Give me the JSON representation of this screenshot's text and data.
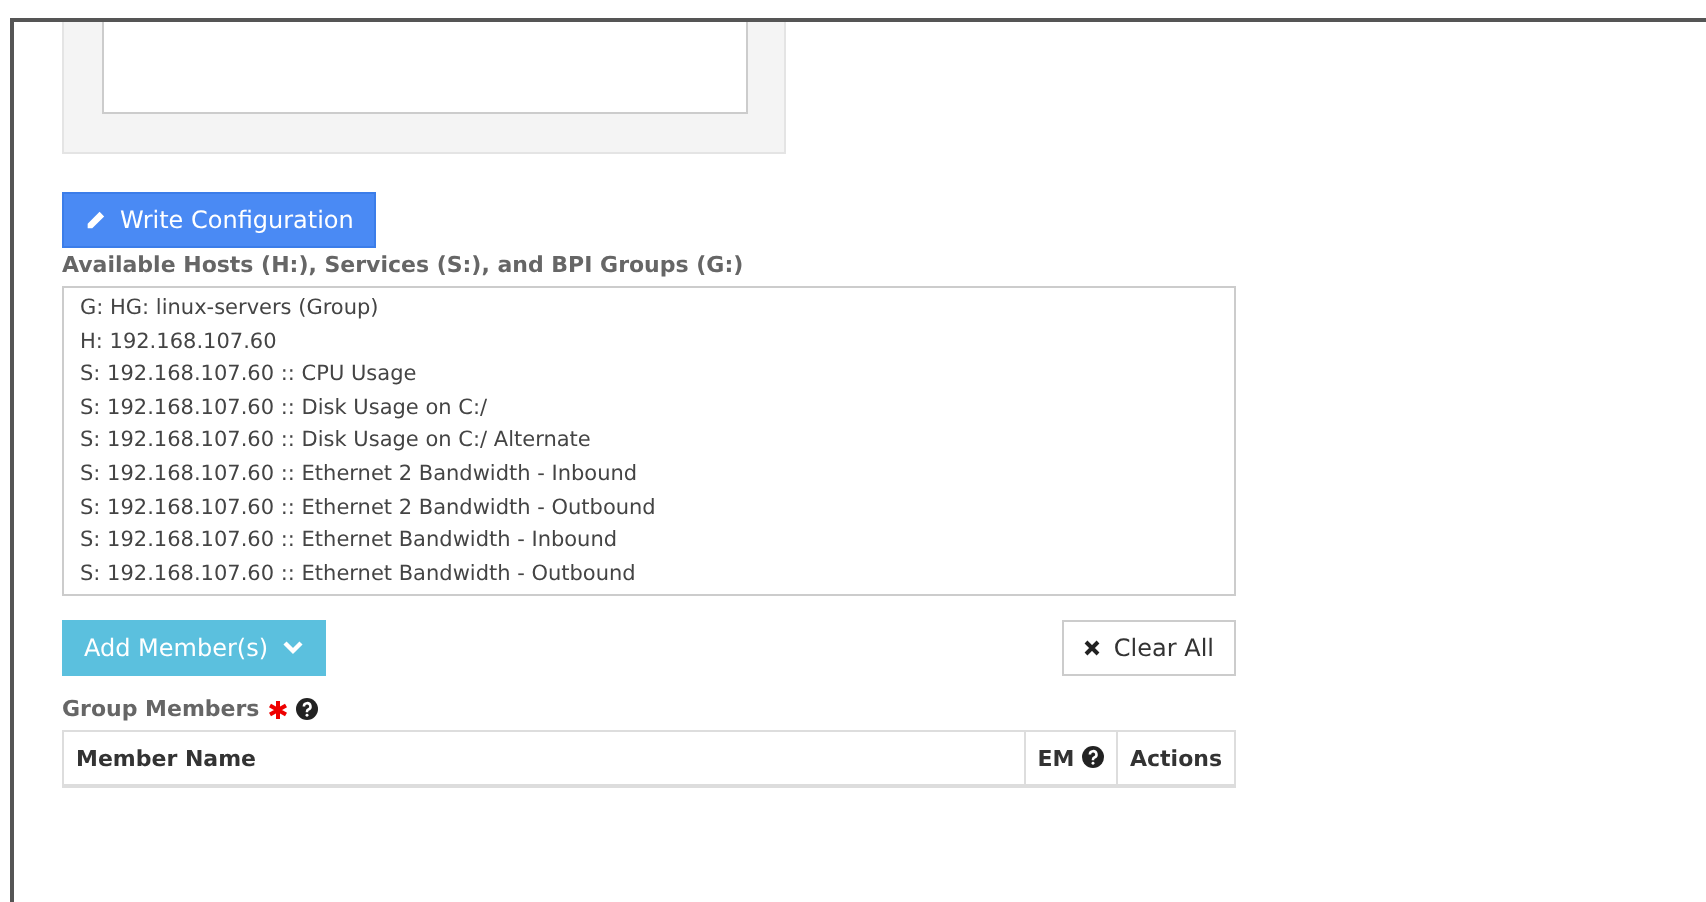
{
  "write_button": {
    "label": "Write Configuration"
  },
  "hosts_label": "Available Hosts (H:), Services (S:), and BPI Groups (G:)",
  "hosts": [
    "G: HG: linux-servers (Group)",
    "H: 192.168.107.60",
    "S: 192.168.107.60 :: CPU Usage",
    "S: 192.168.107.60 :: Disk Usage on C:/",
    "S: 192.168.107.60 :: Disk Usage on C:/ Alternate",
    "S: 192.168.107.60 :: Ethernet 2 Bandwidth - Inbound",
    "S: 192.168.107.60 :: Ethernet 2 Bandwidth - Outbound",
    "S: 192.168.107.60 :: Ethernet Bandwidth - Inbound",
    "S: 192.168.107.60 :: Ethernet Bandwidth - Outbound"
  ],
  "add_button": {
    "label": "Add Member(s)"
  },
  "clear_button": {
    "label": "Clear All"
  },
  "members_label": "Group Members",
  "members_required": true,
  "table": {
    "columns": [
      "Member Name",
      "EM",
      "Actions"
    ]
  }
}
